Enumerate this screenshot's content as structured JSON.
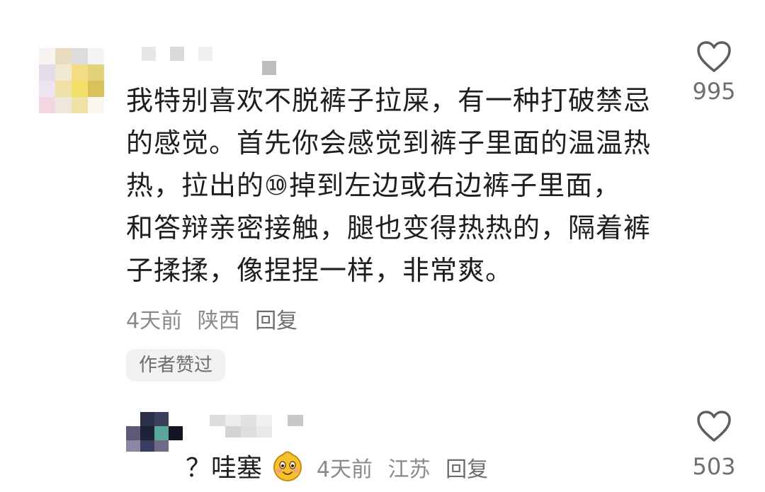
{
  "comments": [
    {
      "text_lines": [
        "我特别喜欢不脱裤子拉屎，有一种打破禁忌",
        "的感觉。首先你会感觉到裤子里面的温温热",
        "热，拉出的⑩掉到左边或右边裤子里面，",
        "和答辩亲密接触，腿也变得热热的，隔着裤",
        "子揉揉，像捏捏一样，非常爽。"
      ],
      "time": "4天前",
      "location": "陕西",
      "reply_label": "回复",
      "badge": "作者赞过",
      "like_count": "995",
      "like_icon": "heart-outline-icon"
    },
    {
      "text_prefix": "？哇塞",
      "emoji": "smiling-face-emoji",
      "time": "4天前",
      "location": "江苏",
      "reply_label": "回复",
      "like_count": "503",
      "like_icon": "heart-outline-icon"
    }
  ]
}
